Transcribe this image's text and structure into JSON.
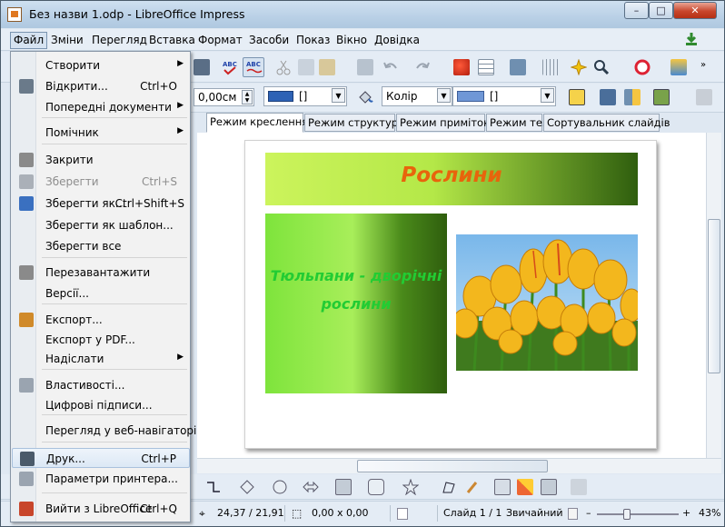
{
  "window": {
    "title": "Без назви 1.odp - LibreOffice Impress",
    "btn_min": "–",
    "btn_max": "□",
    "btn_close": "✕"
  },
  "menubar": [
    "Файл",
    "Зміни",
    "Перегляд",
    "Вставка",
    "Формат",
    "Засоби",
    "Показ",
    "Вікно",
    "Довідка"
  ],
  "toolbar2": {
    "position_value": "0,00см",
    "line_value": "[]",
    "area_style": "Колір",
    "area_value": "[]"
  },
  "tabs": [
    "Режим креслення",
    "Режим структури",
    "Режим приміток",
    "Режим тез",
    "Сортувальник слайдів"
  ],
  "slide": {
    "title": "Рослини",
    "text": "Тюльпани - дворічні рослини"
  },
  "file_menu": {
    "items": [
      {
        "label": "Створити",
        "shortcut": "",
        "submenu": true,
        "disabled": false
      },
      {
        "label": "Відкрити...",
        "shortcut": "Ctrl+O",
        "submenu": false,
        "disabled": false
      },
      {
        "label": "Попередні документи",
        "shortcut": "",
        "submenu": true,
        "disabled": false
      },
      {
        "label": "Помічник",
        "shortcut": "",
        "submenu": true,
        "disabled": false
      },
      {
        "label": "Закрити",
        "shortcut": "",
        "submenu": false,
        "disabled": false
      },
      {
        "label": "Зберегти",
        "shortcut": "Ctrl+S",
        "submenu": false,
        "disabled": true
      },
      {
        "label": "Зберегти як...",
        "shortcut": "Ctrl+Shift+S",
        "submenu": false,
        "disabled": false
      },
      {
        "label": "Зберегти як шаблон...",
        "shortcut": "",
        "submenu": false,
        "disabled": false
      },
      {
        "label": "Зберегти все",
        "shortcut": "",
        "submenu": false,
        "disabled": false
      },
      {
        "label": "Перезавантажити",
        "shortcut": "",
        "submenu": false,
        "disabled": false
      },
      {
        "label": "Версії...",
        "shortcut": "",
        "submenu": false,
        "disabled": false
      },
      {
        "label": "Експорт...",
        "shortcut": "",
        "submenu": false,
        "disabled": false
      },
      {
        "label": "Експорт у PDF...",
        "shortcut": "",
        "submenu": false,
        "disabled": false
      },
      {
        "label": "Надіслати",
        "shortcut": "",
        "submenu": true,
        "disabled": false
      },
      {
        "label": "Властивості...",
        "shortcut": "",
        "submenu": false,
        "disabled": false
      },
      {
        "label": "Цифрові підписи...",
        "shortcut": "",
        "submenu": false,
        "disabled": false
      },
      {
        "label": "Перегляд у веб-навігаторі",
        "shortcut": "",
        "submenu": false,
        "disabled": false
      },
      {
        "label": "Друк...",
        "shortcut": "Ctrl+P",
        "submenu": false,
        "disabled": false
      },
      {
        "label": "Параметри принтера...",
        "shortcut": "",
        "submenu": false,
        "disabled": false
      },
      {
        "label": "Вийти з LibreOffice",
        "shortcut": "Ctrl+Q",
        "submenu": false,
        "disabled": false
      }
    ]
  },
  "status": {
    "position": "24,37 / 21,91",
    "size": "0,00 x 0,00",
    "slide": "Слайд 1 / 1",
    "layout": "Звичайний",
    "zoom": "43%",
    "zoom_minus": "–",
    "zoom_plus": "+"
  },
  "colors": {
    "title_text": "#e8640c",
    "body_text": "#22cc33",
    "accent_blue": "#2d62b5"
  }
}
